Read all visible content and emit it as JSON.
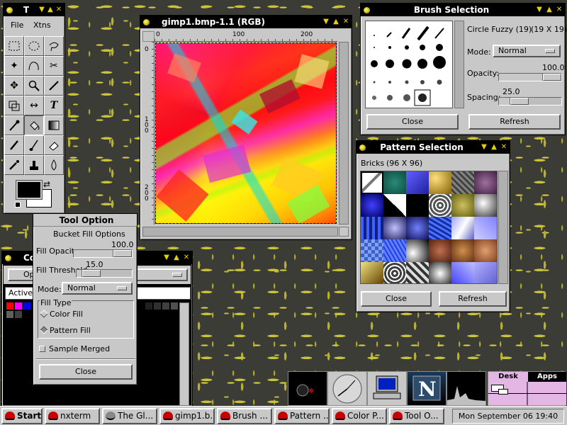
{
  "toolbox": {
    "title": "T",
    "menu": [
      "File",
      "Xtns"
    ]
  },
  "image_window": {
    "title": "gimp1.bmp-1.1 (RGB)",
    "ruler_top": [
      "0",
      "100",
      "200"
    ],
    "ruler_left": [
      "0",
      "100",
      "200"
    ]
  },
  "brush": {
    "title": "Brush Selection",
    "name": "Circle Fuzzy (19)",
    "size": "(19 X 19)",
    "mode_label": "Mode:",
    "mode": "Normal",
    "opacity_label": "Opacity:",
    "opacity": "100.0",
    "opacity_pct": 100,
    "spacing_label": "Spacing:",
    "spacing": "25.0",
    "spacing_pct": 25,
    "close": "Close",
    "refresh": "Refresh"
  },
  "pattern": {
    "title": "Pattern Selection",
    "name": "Bricks",
    "size": "(96 X 96)",
    "close": "Close",
    "refresh": "Refresh"
  },
  "tool_options": {
    "title": "Tool Option",
    "heading": "Bucket Fill Options",
    "fill_opacity_label": "Fill Opacity",
    "fill_opacity": "100.0",
    "fill_opacity_pct": 100,
    "fill_threshold_label": "Fill Threshold",
    "fill_threshold": "15.0",
    "fill_threshold_pct": 15,
    "mode_label": "Mode:",
    "mode": "Normal",
    "fill_type_label": "Fill Type",
    "color_fill": "Color Fill",
    "pattern_fill": "Pattern Fill",
    "sample_merged": "Sample Merged",
    "close": "Close"
  },
  "color_window": {
    "title": "Co",
    "option": "Op",
    "active": "Active"
  },
  "dock": {
    "desk": "Desk",
    "apps": "Apps"
  },
  "taskbar": {
    "start": "Start",
    "tasks": [
      "nxterm",
      "The Gl...",
      "gimp1.b...",
      "Brush ...",
      "Pattern ...",
      "Color P...",
      "Tool O..."
    ],
    "clock": "Mon September 06 19:40"
  },
  "colors": {
    "title_bar": "#000000",
    "title_ctrl": "#e6d200",
    "panel": "#c8c8c8"
  }
}
